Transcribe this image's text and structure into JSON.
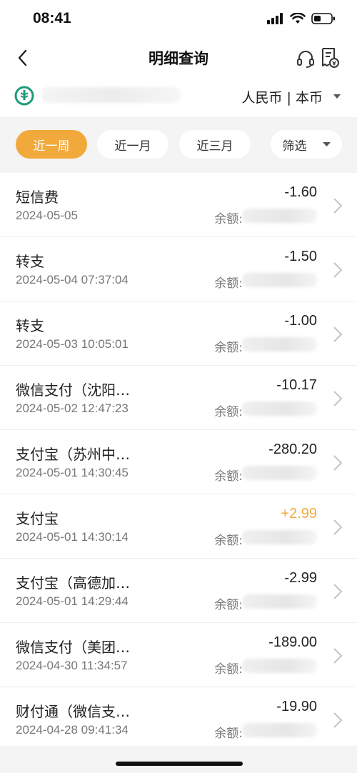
{
  "status": {
    "time": "08:41"
  },
  "nav": {
    "title": "明细查询"
  },
  "account": {
    "currency": "人民币 | 本币"
  },
  "filters": [
    {
      "label": "近一周",
      "active": true
    },
    {
      "label": "近一月",
      "active": false
    },
    {
      "label": "近三月",
      "active": false
    },
    {
      "label": "筛选",
      "active": false
    }
  ],
  "balance_label": "余额:",
  "transactions": [
    {
      "title": "短信费",
      "date": "2024-05-05",
      "amount": "-1.60"
    },
    {
      "title": "转支",
      "date": "2024-05-04 07:37:04",
      "amount": "-1.50"
    },
    {
      "title": "转支",
      "date": "2024-05-03 10:05:01",
      "amount": "-1.00"
    },
    {
      "title": "微信支付（沈阳…",
      "date": "2024-05-02 12:47:23",
      "amount": "-10.17"
    },
    {
      "title": "支付宝（苏州中…",
      "date": "2024-05-01 14:30:45",
      "amount": "-280.20"
    },
    {
      "title": "支付宝",
      "date": "2024-05-01 14:30:14",
      "amount": "+2.99",
      "positive": true
    },
    {
      "title": "支付宝（高德加…",
      "date": "2024-05-01 14:29:44",
      "amount": "-2.99"
    },
    {
      "title": "微信支付（美团…",
      "date": "2024-04-30 11:34:57",
      "amount": "-189.00"
    },
    {
      "title": "财付通（微信支…",
      "date": "2024-04-28 09:41:34",
      "amount": "-19.90"
    }
  ],
  "colors": {
    "accent": "#f2a93b",
    "bank_green": "#1d9a7a"
  }
}
